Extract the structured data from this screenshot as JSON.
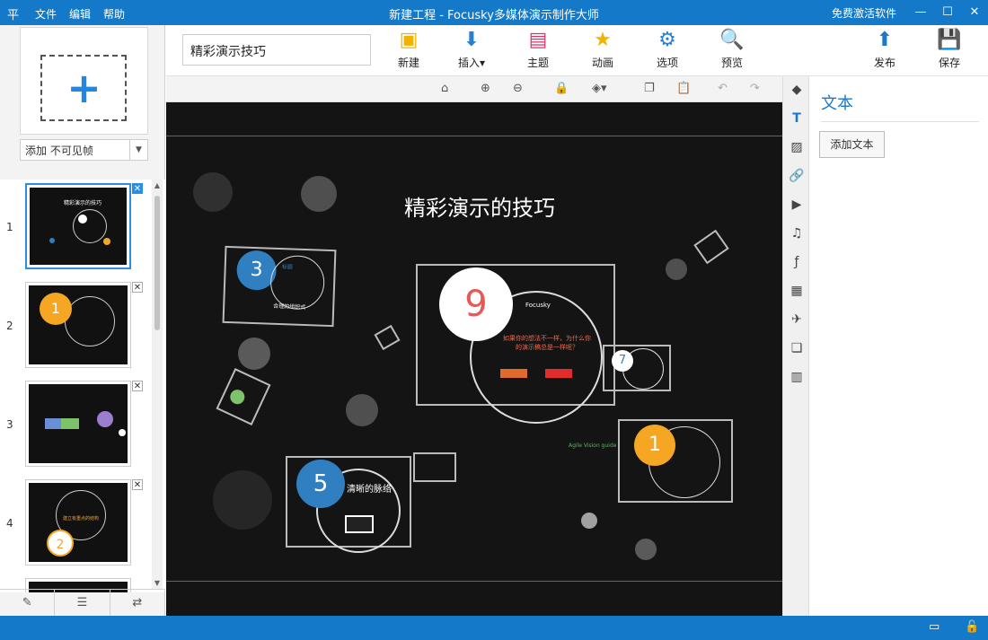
{
  "titlebar": {
    "logo": "平",
    "menu": [
      "文件",
      "编辑",
      "帮助"
    ],
    "title": "新建工程 - Focusky多媒体演示制作大师",
    "activate": "免费激活软件",
    "minimize": "—",
    "maximize": "☐",
    "close": "✕"
  },
  "left": {
    "add_frame_label": "添加 不可见帧",
    "thumbnails": [
      {
        "num": "1",
        "title": "精彩演示的技巧"
      },
      {
        "num": "2",
        "badge": "1"
      },
      {
        "num": "3"
      },
      {
        "num": "4",
        "badge": "2",
        "title": "建立有重点的结构"
      }
    ]
  },
  "toolbar": {
    "project_name": "精彩演示技巧",
    "buttons": [
      {
        "label": "新建",
        "icon": "new-icon"
      },
      {
        "label": "插入▾",
        "icon": "insert-icon"
      },
      {
        "label": "主题",
        "icon": "theme-icon"
      },
      {
        "label": "动画",
        "icon": "animation-icon"
      },
      {
        "label": "选项",
        "icon": "options-icon"
      },
      {
        "label": "预览",
        "icon": "preview-icon"
      },
      {
        "label": "发布",
        "icon": "publish-icon"
      },
      {
        "label": "保存",
        "icon": "save-icon"
      }
    ]
  },
  "canvas": {
    "title": "精彩演示的技巧",
    "frame3_num": "3",
    "frame3_caption": "合理的组织式",
    "frame3_label": "标题",
    "frame9_num": "9",
    "frame9_brand": "Focusky",
    "frame9_text": "如果你的想法不一样，为什么你的演示稿总是一样呢？",
    "frame7_num": "7",
    "frame1_num": "1",
    "frame5_num": "5",
    "frame5_title": "清晰的脉络",
    "guide_text": "Agile Vision guide"
  },
  "right": {
    "heading": "文本",
    "add_text": "添加文本"
  },
  "colors": {
    "accent": "#1479c9",
    "badge_blue": "#2f7fc1",
    "badge_orange": "#f5a623",
    "badge_red": "#e85858"
  }
}
